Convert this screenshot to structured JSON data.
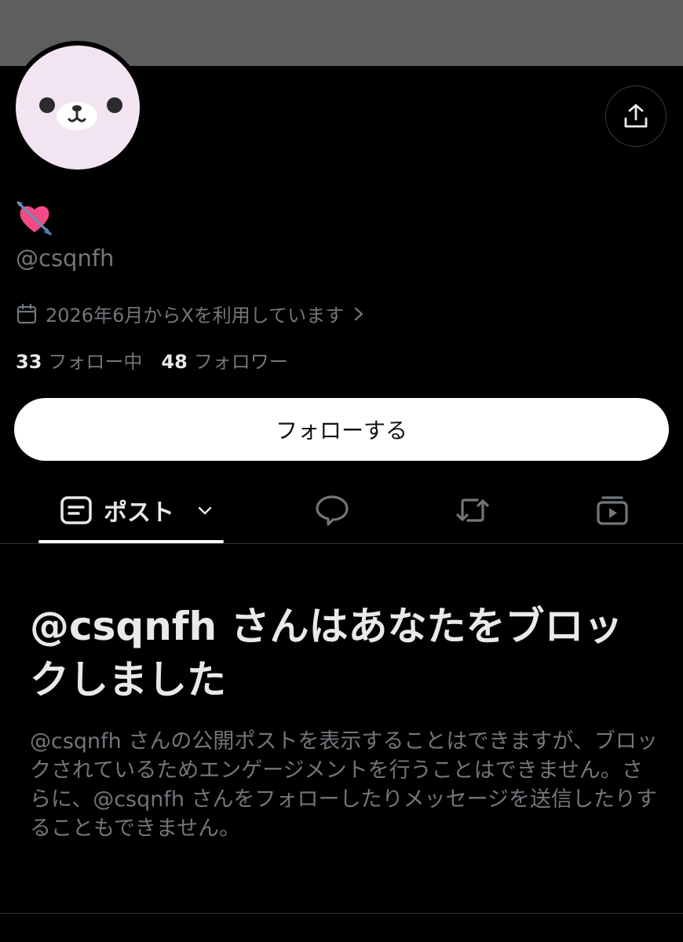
{
  "profile": {
    "display_name_emoji": "💘",
    "handle": "@csqnfh",
    "joined_text": "2026年6月からXを利用しています",
    "following_count": "33",
    "following_label": "フォロー中",
    "followers_count": "48",
    "followers_label": "フォロワー",
    "follow_button_label": "フォローする"
  },
  "tabs": {
    "posts_label": "ポスト"
  },
  "blocked_notice": {
    "title": "@csqnfh さんはあなたをブロックしました",
    "body": "@csqnfh さんの公開ポストを表示することはできますが、ブロックされているためエンゲージメントを行うことはできません。さらに、@csqnfh さんをフォローしたりメッセージを送信したりすることもできません。"
  },
  "icons": [
    "share-icon",
    "calendar-icon",
    "chevron-right-icon",
    "posts-icon",
    "chevron-down-icon",
    "reply-icon",
    "repost-icon",
    "media-icon"
  ],
  "colors": {
    "background": "#000000",
    "banner": "#5e5e5e",
    "text_primary": "#e7e9ea",
    "text_secondary": "#71767b",
    "avatar_bg": "#f3e4f1"
  }
}
